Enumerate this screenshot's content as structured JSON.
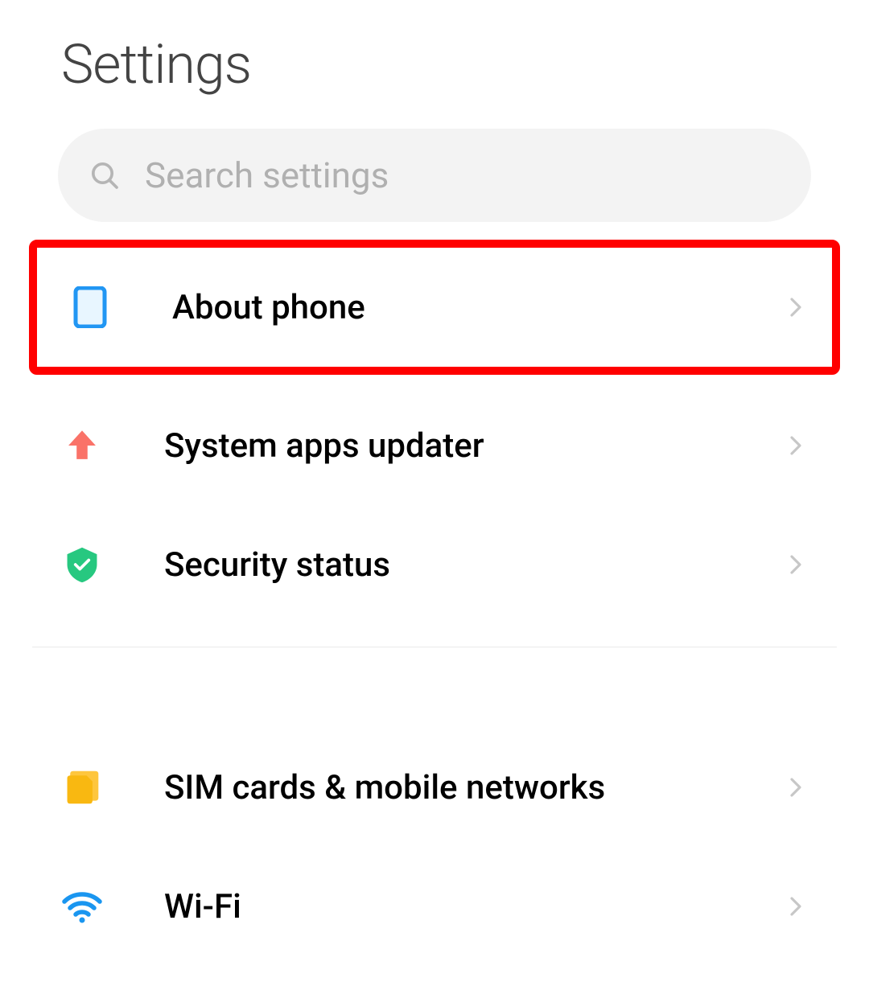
{
  "title": "Settings",
  "search": {
    "placeholder": "Search settings"
  },
  "items": [
    {
      "label": "About phone",
      "highlighted": true
    },
    {
      "label": "System apps updater",
      "highlighted": false
    },
    {
      "label": "Security status",
      "highlighted": false
    },
    {
      "label": "SIM cards & mobile networks",
      "highlighted": false
    },
    {
      "label": "Wi-Fi",
      "highlighted": false
    }
  ]
}
